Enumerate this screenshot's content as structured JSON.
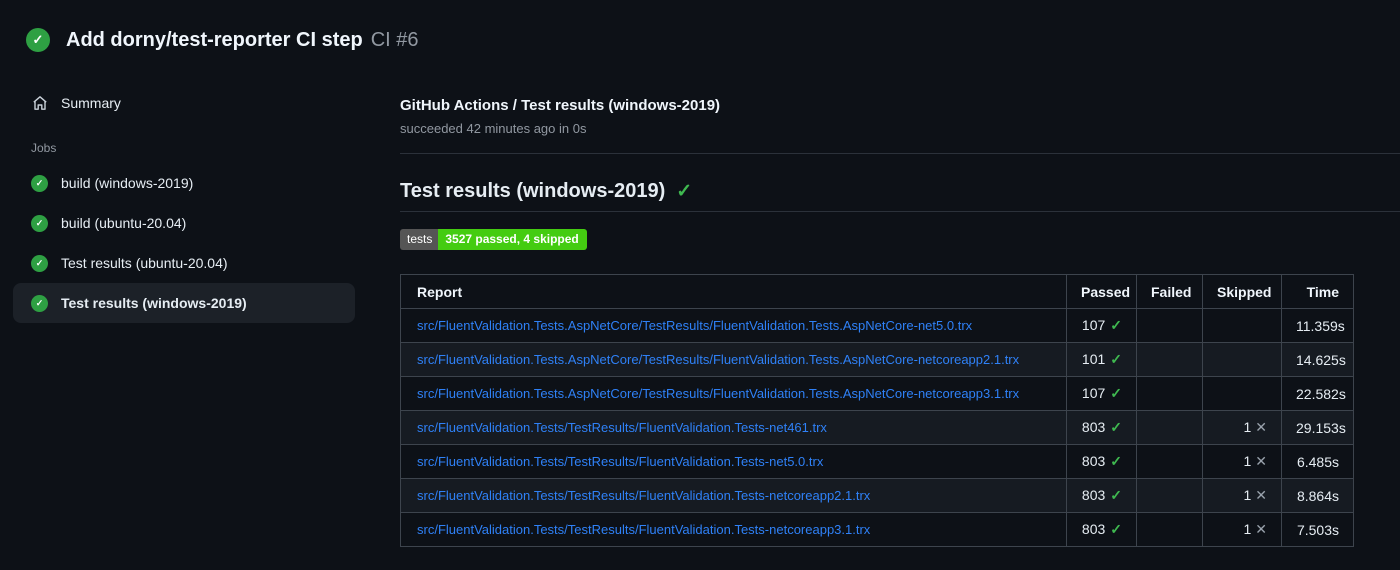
{
  "header": {
    "title": "Add dorny/test-reporter CI step",
    "run_number": "CI #6"
  },
  "icons": {
    "check": "✓",
    "cross": "✕"
  },
  "colors": {
    "success_circle": "#2ea043",
    "success_check": "#3fb950",
    "link_blue": "#2f81f7",
    "badge_label_bg": "#555555",
    "badge_value_bg": "#44cc11",
    "background": "#0d1117"
  },
  "sidebar": {
    "summary_label": "Summary",
    "jobs_label": "Jobs",
    "jobs": [
      {
        "label": "build (windows-2019)",
        "selected": false
      },
      {
        "label": "build (ubuntu-20.04)",
        "selected": false
      },
      {
        "label": "Test results (ubuntu-20.04)",
        "selected": false
      },
      {
        "label": "Test results (windows-2019)",
        "selected": true
      }
    ]
  },
  "main": {
    "run_title": "GitHub Actions / Test results (windows-2019)",
    "run_status": "succeeded 42 minutes ago in 0s",
    "section_title": "Test results (windows-2019)",
    "badge": {
      "label": "tests",
      "value": "3527 passed, 4 skipped"
    },
    "table": {
      "headers": {
        "report": "Report",
        "passed": "Passed",
        "failed": "Failed",
        "skipped": "Skipped",
        "time": "Time"
      },
      "rows": [
        {
          "report": "src/FluentValidation.Tests.AspNetCore/TestResults/FluentValidation.Tests.AspNetCore-net5.0.trx",
          "passed": "107",
          "failed": "",
          "skipped": "",
          "time": "11.359s"
        },
        {
          "report": "src/FluentValidation.Tests.AspNetCore/TestResults/FluentValidation.Tests.AspNetCore-netcoreapp2.1.trx",
          "passed": "101",
          "failed": "",
          "skipped": "",
          "time": "14.625s"
        },
        {
          "report": "src/FluentValidation.Tests.AspNetCore/TestResults/FluentValidation.Tests.AspNetCore-netcoreapp3.1.trx",
          "passed": "107",
          "failed": "",
          "skipped": "",
          "time": "22.582s"
        },
        {
          "report": "src/FluentValidation.Tests/TestResults/FluentValidation.Tests-net461.trx",
          "passed": "803",
          "failed": "",
          "skipped": "1",
          "time": "29.153s"
        },
        {
          "report": "src/FluentValidation.Tests/TestResults/FluentValidation.Tests-net5.0.trx",
          "passed": "803",
          "failed": "",
          "skipped": "1",
          "time": "6.485s"
        },
        {
          "report": "src/FluentValidation.Tests/TestResults/FluentValidation.Tests-netcoreapp2.1.trx",
          "passed": "803",
          "failed": "",
          "skipped": "1",
          "time": "8.864s"
        },
        {
          "report": "src/FluentValidation.Tests/TestResults/FluentValidation.Tests-netcoreapp3.1.trx",
          "passed": "803",
          "failed": "",
          "skipped": "1",
          "time": "7.503s"
        }
      ]
    }
  }
}
